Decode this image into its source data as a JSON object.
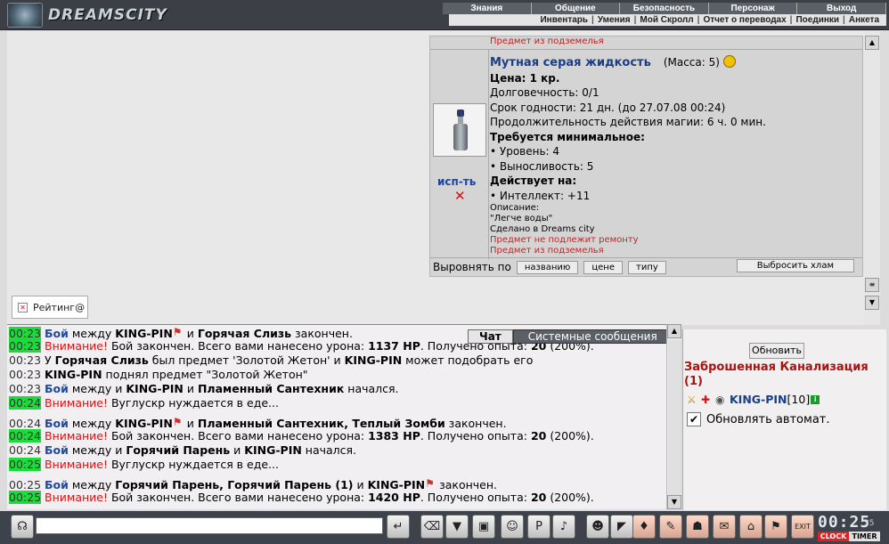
{
  "header": {
    "logo_text": "DREAMSCITY",
    "nav_top": [
      "Знания",
      "Общение",
      "Безопасность",
      "Персонаж",
      "Выход"
    ],
    "nav_bottom": [
      "Инвентарь",
      "Умения",
      "Мой Скролл",
      "Отчет о переводах",
      "Поединки",
      "Анкета"
    ]
  },
  "item": {
    "top_label": "Предмет из подземелья",
    "name": "Мутная серая жидкость",
    "mass": "(Масса: 5)",
    "price": "Цена: 1 кр.",
    "durability": "Долговечность: 0/1",
    "expiry": "Срок годности: 21 дн. (до 27.07.08 00:24)",
    "magic_duration": "Продолжительность действия магии: 6 ч. 0 мин.",
    "req_title": "Требуется минимальное:",
    "req_level": "• Уровень: 4",
    "req_stamina": "• Выносливость: 5",
    "effect_title": "Действует на:",
    "effect_int": "• Интеллект: +11",
    "desc_label": "Описание:",
    "desc_text": "\"Легче воды\"",
    "made_in": "Сделано в Dreams city",
    "no_repair": "Предмет не подлежит ремонту",
    "dungeon": "Предмет из подземелья",
    "use_label": "исп-ть",
    "delete_icon": "✕"
  },
  "sort": {
    "label": "Выровнять по",
    "by_name": "названию",
    "by_price": "цене",
    "by_type": "типу",
    "trash": "Выбросить хлам"
  },
  "rating": {
    "label": "Рейтинг@"
  },
  "chat_tabs": {
    "chat": "Чат",
    "system": "Системные сообщения"
  },
  "chat": [
    {
      "ts": "00:23",
      "hl": true,
      "parts": [
        [
          "n",
          "Бой"
        ],
        [
          "t",
          " между "
        ],
        [
          "b",
          "KING-PIN"
        ],
        [
          "f",
          ""
        ],
        [
          "t",
          " и "
        ],
        [
          "b",
          "Горячая Слизь"
        ],
        [
          "t",
          " закончен."
        ]
      ]
    },
    {
      "ts": "00:23",
      "hl": true,
      "parts": [
        [
          "w",
          "Внимание!"
        ],
        [
          "t",
          " Бой закончен. Всего вами нанесено урона: "
        ],
        [
          "b",
          "1137 HP"
        ],
        [
          "t",
          ". Получено опыта: "
        ],
        [
          "b",
          "20"
        ],
        [
          "t",
          " (200%)."
        ]
      ]
    },
    {
      "ts": "00:23",
      "hl": false,
      "parts": [
        [
          "t",
          "У "
        ],
        [
          "b",
          "Горячая Слизь"
        ],
        [
          "t",
          " был предмет 'Золотой Жетон' и "
        ],
        [
          "b",
          "KING-PIN"
        ],
        [
          "t",
          " может подобрать его"
        ]
      ]
    },
    {
      "ts": "00:23",
      "hl": false,
      "parts": [
        [
          "b",
          "KING-PIN"
        ],
        [
          "t",
          " поднял предмет \"Золотой Жетон\""
        ]
      ]
    },
    {
      "ts": "00:23",
      "hl": false,
      "parts": [
        [
          "n",
          "Бой"
        ],
        [
          "t",
          " между и "
        ],
        [
          "b",
          "KING-PIN"
        ],
        [
          "t",
          " и "
        ],
        [
          "b",
          "Пламенный Сантехник"
        ],
        [
          "t",
          " начался."
        ]
      ]
    },
    {
      "ts": "00:24",
      "hl": true,
      "parts": [
        [
          "w",
          "Внимание!"
        ],
        [
          "t",
          " Вуглускр нуждается в еде..."
        ]
      ]
    },
    {
      "gap": true
    },
    {
      "ts": "00:24",
      "hl": false,
      "parts": [
        [
          "n",
          "Бой"
        ],
        [
          "t",
          " между "
        ],
        [
          "b",
          "KING-PIN"
        ],
        [
          "f",
          ""
        ],
        [
          "t",
          " и "
        ],
        [
          "b",
          "Пламенный Сантехник, Теплый Зомби"
        ],
        [
          "t",
          " закончен."
        ]
      ]
    },
    {
      "ts": "00:24",
      "hl": true,
      "parts": [
        [
          "w",
          "Внимание!"
        ],
        [
          "t",
          " Бой закончен. Всего вами нанесено урона: "
        ],
        [
          "b",
          "1383 HP"
        ],
        [
          "t",
          ". Получено опыта: "
        ],
        [
          "b",
          "20"
        ],
        [
          "t",
          " (200%)."
        ]
      ]
    },
    {
      "ts": "00:24",
      "hl": false,
      "parts": [
        [
          "n",
          "Бой"
        ],
        [
          "t",
          " между и "
        ],
        [
          "b",
          "Горячий Парень"
        ],
        [
          "t",
          " и "
        ],
        [
          "b",
          "KING-PIN"
        ],
        [
          "t",
          " начался."
        ]
      ]
    },
    {
      "ts": "00:25",
      "hl": true,
      "parts": [
        [
          "w",
          "Внимание!"
        ],
        [
          "t",
          " Вуглускр нуждается в еде..."
        ]
      ]
    },
    {
      "gap": true
    },
    {
      "ts": "00:25",
      "hl": false,
      "parts": [
        [
          "n",
          "Бой"
        ],
        [
          "t",
          " между "
        ],
        [
          "b",
          "Горячий Парень, Горячий Парень (1)"
        ],
        [
          "t",
          " и "
        ],
        [
          "b",
          "KING-PIN"
        ],
        [
          "f",
          ""
        ],
        [
          "t",
          " закончен."
        ]
      ]
    },
    {
      "ts": "00:25",
      "hl": true,
      "parts": [
        [
          "w",
          "Внимание!"
        ],
        [
          "t",
          " Бой закончен. Всего вами нанесено урона: "
        ],
        [
          "b",
          "1420 HP"
        ],
        [
          "t",
          ". Получено опыта: "
        ],
        [
          "b",
          "20"
        ],
        [
          "t",
          " (200%)."
        ]
      ]
    }
  ],
  "right_panel": {
    "refresh": "Обновить",
    "location": "Заброшенная Канализация (1)",
    "player_name": "KING-PIN",
    "player_level": "[10]",
    "auto_label": "Обновлять автомат.",
    "auto_checked": "✔"
  },
  "toolbar": {
    "input_placeholder": "",
    "time": "00:25",
    "seconds": "35",
    "clock_label": "CLOCK",
    "timer_label": "TIMER"
  },
  "colors": {
    "highlight": "#1bdc3a",
    "link": "#1a3d86",
    "warn": "#d11"
  }
}
